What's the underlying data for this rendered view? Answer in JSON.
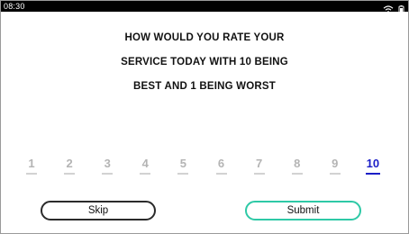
{
  "status_bar": {
    "time": "08:30",
    "icons": [
      "wifi-icon",
      "battery-icon"
    ]
  },
  "question": {
    "lines": [
      "HOW WOULD YOU RATE YOUR",
      "SERVICE TODAY WITH 10 BEING",
      "BEST AND 1 BEING WORST"
    ]
  },
  "scale": {
    "options": [
      "1",
      "2",
      "3",
      "4",
      "5",
      "6",
      "7",
      "8",
      "9",
      "10"
    ],
    "selected": "10"
  },
  "buttons": {
    "skip_label": "Skip",
    "submit_label": "Submit"
  },
  "colors": {
    "selected": "#1b1ec7",
    "unselected": "#b4b4b4",
    "submit_border": "#2ec9a6",
    "skip_border": "#2a2a2a"
  }
}
